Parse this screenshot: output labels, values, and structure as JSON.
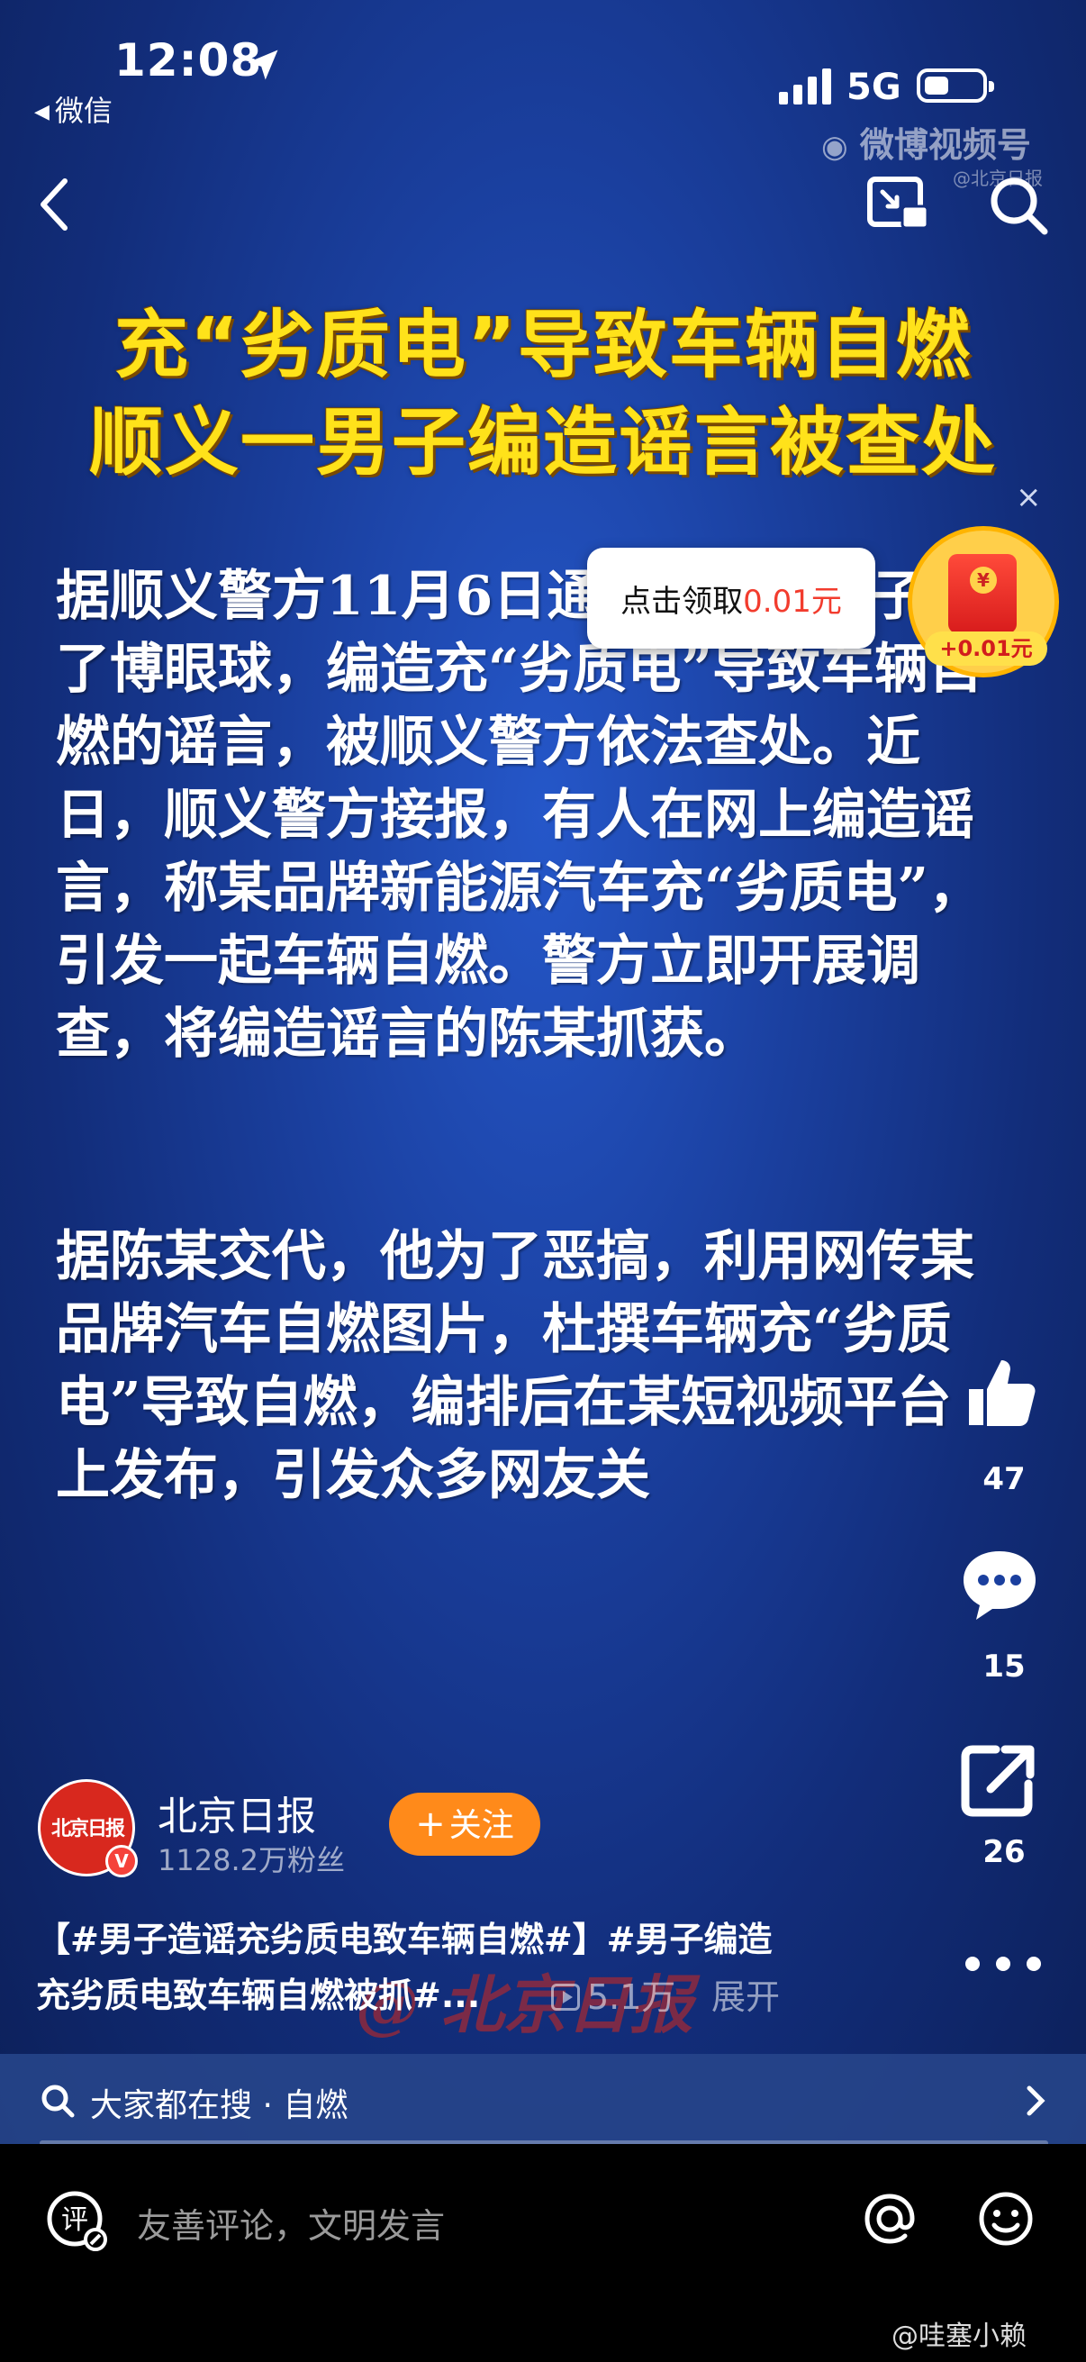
{
  "status_bar": {
    "time": "12:08",
    "back_app": "微信",
    "network": "5G"
  },
  "watermark": {
    "brand": "微博视频号",
    "account": "@北京日报"
  },
  "video": {
    "headline_line1": "充“劣质电”导致车辆自燃",
    "headline_line2": "顺义一男子编造谣言被查处",
    "paragraph1": "据顺义警方11月6日通报，这一男子为了博眼球，编造充“劣质电”导致车辆自燃的谣言，被顺义警方依法查处。近日，顺义警方接报，有人在网上编造谣言，称某品牌新能源汽车充“劣质电”，引发一起车辆自燃。警方立即开展调查，将编造谣言的陈某抓获。",
    "paragraph2": "据陈某交代，他为了恶搞，利用网传某品牌汽车自燃图片，杜撰车辆充“劣质电”导致自燃，编排后在某短视频平台上发布，引发众多网友关"
  },
  "reward_popup": {
    "text": "点击领取",
    "amount": "0.01元",
    "badge": "+0.01元",
    "close": "×"
  },
  "actions": {
    "likes": "47",
    "comments": "15",
    "shares": "26"
  },
  "author": {
    "name": "北京日报",
    "followers": "1128.2万粉丝",
    "avatar_text": "北京日报",
    "verified": "V",
    "follow_label": "关注",
    "follow_plus": "+"
  },
  "caption": {
    "line1": "【#男子造谣充劣质电致车辆自燃#】#男子编造",
    "line2": "充劣质电致车辆自燃被抓#...",
    "views": "5.1万",
    "expand": "展开",
    "overlay_watermark": "@ 北京日报"
  },
  "search_strip": {
    "text": "大家都在搜 · 自燃"
  },
  "comment_bar": {
    "icon_text": "评",
    "placeholder": "友善评论，文明发言"
  },
  "footer_watermark": "@哇塞小赖",
  "colors": {
    "headline": "#ffe21a",
    "follow": "#ff8a1a",
    "amount": "#f23c2e",
    "background": "#1a3f9e"
  }
}
